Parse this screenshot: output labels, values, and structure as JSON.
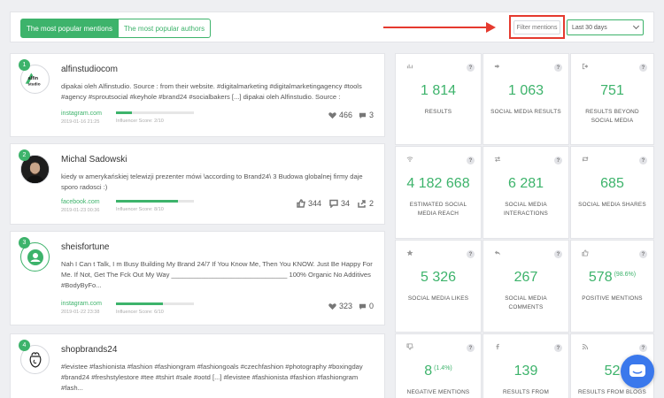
{
  "tabs": [
    {
      "label": "The most popular mentions",
      "active": true
    },
    {
      "label": "The most popular authors",
      "active": false
    }
  ],
  "filter_label": "Filter mentions",
  "period_label": "Last 30 days",
  "colors": {
    "accent": "#3db36b",
    "highlight": "#e53a2f",
    "chat": "#3a78ec"
  },
  "mentions": [
    {
      "rank": "1",
      "author": "alfinstudiocom",
      "avatar_text": "alfin studio",
      "text": "dipakai oleh Alfinstudio. Source : from their website. #digitalmarketing #digitalmarketingagency #tools #agency #sproutsocial #keyhole #brand24 #socialbakers [...] dipakai oleh Alfinstudio. Source :",
      "source": "instagram.com",
      "date": "2019-01-16 21:25",
      "influencer_score": "Influencer Score: 2/10",
      "score_fraction": 0.2,
      "likes": "466",
      "comments": "3"
    },
    {
      "rank": "2",
      "author": "Michal Sadowski",
      "text": "kiedy w amerykańskiej telewizji prezenter mówi \\according to Brand24\\ 3 Budowa globalnej firmy daje sporo radosci :)",
      "source": "facebook.com",
      "date": "2019-01-23 00:36",
      "influencer_score": "Influencer Score: 8/10",
      "score_fraction": 0.8,
      "likes": "344",
      "comments": "34",
      "shares": "2"
    },
    {
      "rank": "3",
      "author": "sheisfortune",
      "text": "Nah I Can t Talk, I m Busy Building My Brand 24/7 If You Know Me, Then You KNOW. Just Be Happy For Me. If Not, Get The Fck Out My Way _______________________________ 100% Organic No Additives #BodyByFo...",
      "source": "instagram.com",
      "date": "2019-01-22 23:38",
      "influencer_score": "Influencer Score: 6/10",
      "score_fraction": 0.6,
      "likes": "323",
      "comments": "0"
    },
    {
      "rank": "4",
      "author": "shopbrands24",
      "text": "#levistee #fashionista #fashion #fashiongram #fashiongoals #czechfashion #photography #boxingday #brand24 #freshstylestore #tee #tshirt #sale #ootd [...] #levistee #fashionista #fashion #fashiongram #fash..."
    }
  ],
  "stats": [
    {
      "icon": "bar-chart-icon",
      "value": "1 814",
      "label": "RESULTS"
    },
    {
      "icon": "sign-in-icon",
      "value": "1 063",
      "label": "SOCIAL MEDIA RESULTS"
    },
    {
      "icon": "sign-out-icon",
      "value": "751",
      "label": "RESULTS BEYOND SOCIAL MEDIA"
    },
    {
      "icon": "wifi-icon",
      "value": "4 182 668",
      "label": "ESTIMATED SOCIAL MEDIA REACH"
    },
    {
      "icon": "exchange-icon",
      "value": "6 281",
      "label": "SOCIAL MEDIA INTERACTIONS"
    },
    {
      "icon": "retweet-icon",
      "value": "685",
      "label": "SOCIAL MEDIA SHARES"
    },
    {
      "icon": "star-icon",
      "value": "5 326",
      "label": "SOCIAL MEDIA LIKES"
    },
    {
      "icon": "reply-icon",
      "value": "267",
      "label": "SOCIAL MEDIA COMMENTS"
    },
    {
      "icon": "thumbs-up-icon",
      "value": "578",
      "sup": "(98.6%)",
      "label": "POSITIVE MENTIONS"
    },
    {
      "icon": "thumbs-down-icon",
      "value": "8",
      "sup": "(1.4%)",
      "label": "NEGATIVE MENTIONS"
    },
    {
      "icon": "facebook-icon",
      "value": "139",
      "label": "RESULTS FROM FACEBOOK"
    },
    {
      "icon": "rss-icon",
      "value": "52",
      "label": "RESULTS FROM BLOGS"
    }
  ]
}
